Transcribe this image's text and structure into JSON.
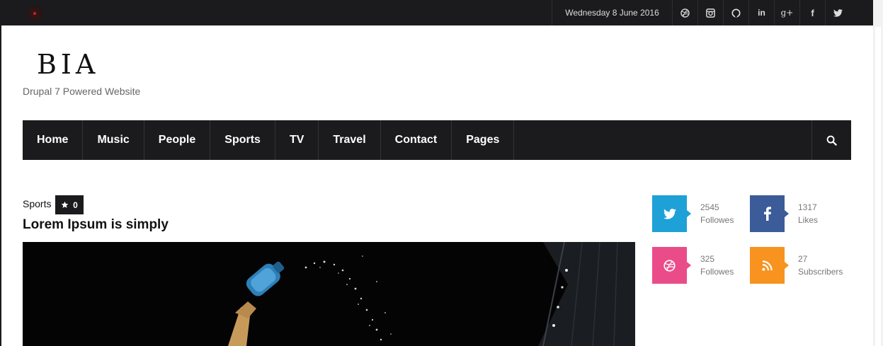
{
  "topbar": {
    "date": "Wednesday 8 June 2016",
    "social_icons": [
      "dribbble-icon",
      "instagram-icon",
      "github-icon",
      "linkedin-icon",
      "google-plus-icon",
      "facebook-icon",
      "twitter-icon"
    ],
    "linkedin_text": "in",
    "googleplus_text": "g+",
    "facebook_text": "f"
  },
  "site": {
    "logo": "BIA",
    "tagline": "Drupal 7 Powered Website"
  },
  "nav": {
    "items": [
      "Home",
      "Music",
      "People",
      "Sports",
      "TV",
      "Travel",
      "Contact",
      "Pages"
    ]
  },
  "article": {
    "category": "Sports",
    "rating": "0",
    "title": "Lorem Ipsum is simply"
  },
  "counters": [
    {
      "network": "twitter",
      "count": "2545",
      "label": "Followes",
      "color": "#1da1d6"
    },
    {
      "network": "facebook",
      "count": "1317",
      "label": "Likes",
      "color": "#3b5b99"
    },
    {
      "network": "dribbble",
      "count": "325",
      "label": "Followes",
      "color": "#ea4c89"
    },
    {
      "network": "rss",
      "count": "27",
      "label": "Subscribers",
      "color": "#f7931e"
    }
  ],
  "colors": {
    "dark": "#1b1b1d",
    "page": "#ffffff",
    "accent_loader": "#d02020"
  }
}
